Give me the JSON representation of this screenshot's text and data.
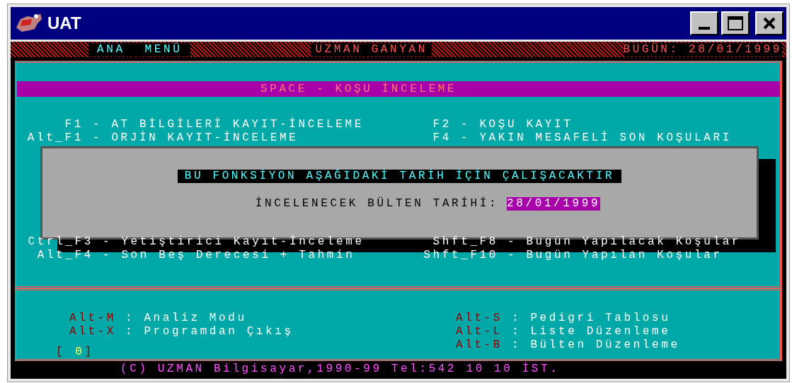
{
  "window": {
    "title": "UAT"
  },
  "header": {
    "menu": [
      "ANA",
      "MENÜ"
    ],
    "program": "UZMAN GANYAN",
    "date": "BUGÜN: 28/01/1999"
  },
  "screen_title": "SPACE - KOŞU İNCELEME",
  "top_options": [
    {
      "left": {
        "key": "F1",
        "text": "- AT BİLGİLERİ KAYIT-İNCELEME"
      },
      "right": {
        "key": "F2",
        "text": "- KOŞU KAYIT"
      }
    },
    {
      "left": {
        "key": "Alt_F1",
        "text": "- ORJİN KAYIT-İNCELEME"
      },
      "right": {
        "key": "F4",
        "text": "- YAKIN MESAFELİ SON KOŞULARI"
      }
    }
  ],
  "dialog": {
    "message": "BU FONKSİYON AŞAĞIDAKİ TARİH İÇİN ÇALIŞACAKTIR",
    "field_label": "İNCELENECEK BÜLTEN TARİHİ:",
    "field_value": "28/01/1999"
  },
  "bottom_options": [
    {
      "left": {
        "key": "Ctrl_F3",
        "text": "- Yetiştirici Kayıt-İnceleme"
      },
      "right": {
        "key": "Shft_F8",
        "text": "- Bugün Yapılacak Koşular"
      }
    },
    {
      "left": {
        "key": "Alt_F4",
        "text": "- Son Beş Derecesi + Tahmin"
      },
      "right": {
        "key": "Shft_F10",
        "text": "- Bugün Yapılan Koşular"
      }
    }
  ],
  "hotkeys_left": [
    {
      "key": "Alt-M",
      "text": ": Analiz Modu"
    },
    {
      "key": "Alt-X",
      "text": ": Programdan Çıkış"
    }
  ],
  "hotkeys_right": [
    {
      "key": "Alt-S",
      "text": ": Pedigri Tablosu"
    },
    {
      "key": "Alt-L",
      "text": ": Liste Düzenleme"
    },
    {
      "key": "Alt-B",
      "text": ": Bülten Düzenleme"
    }
  ],
  "counter": {
    "open": "[",
    "value": "0",
    "close": "]"
  },
  "footer": "(C) UZMAN Bilgisayar,1990-99 Tel:542 10 10 İST."
}
